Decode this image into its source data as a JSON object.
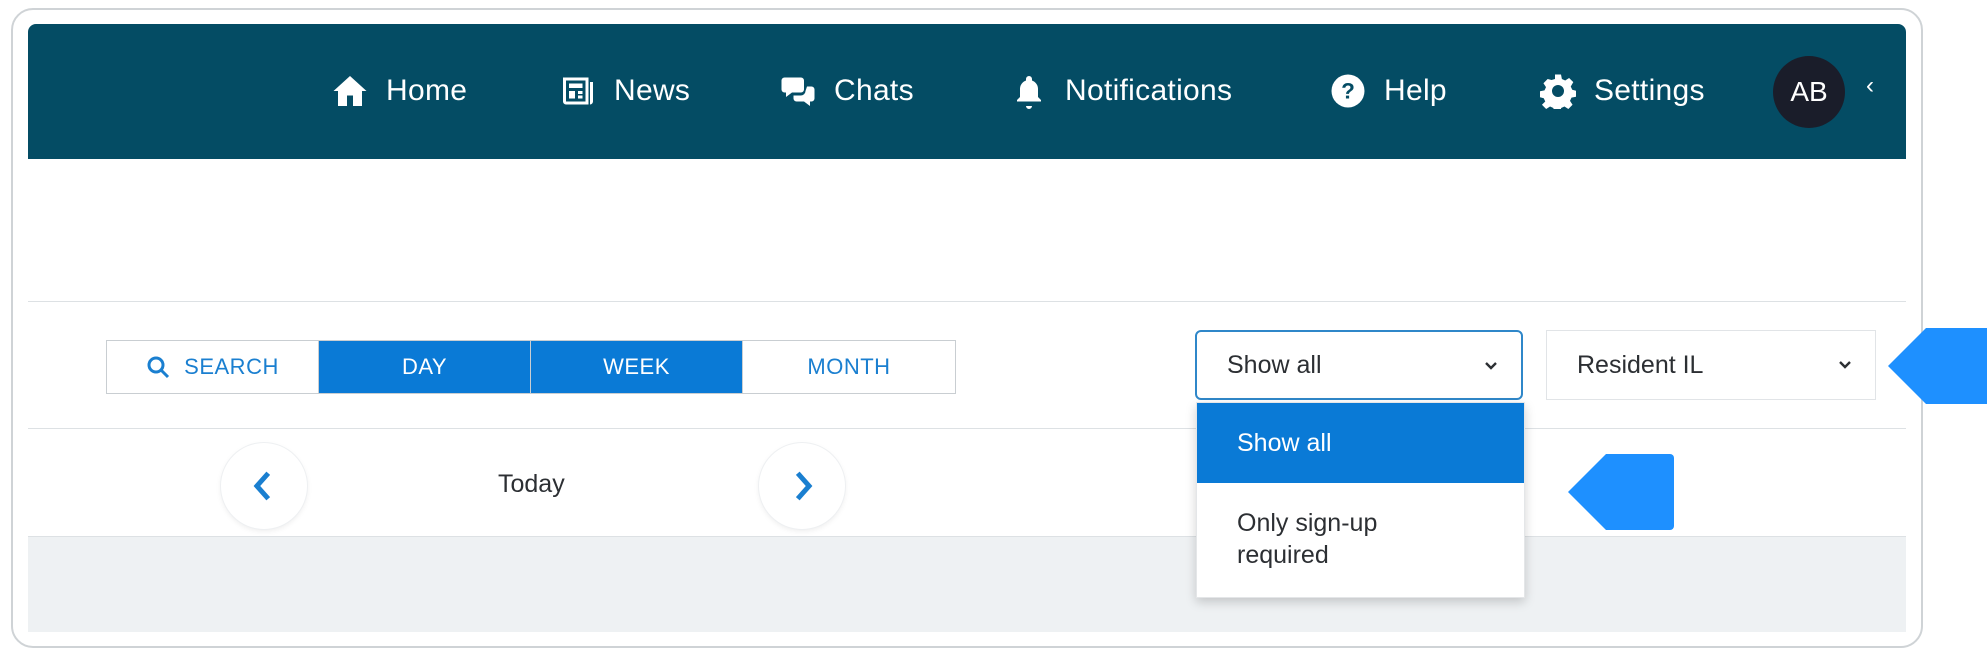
{
  "nav": {
    "home": "Home",
    "news": "News",
    "chats": "Chats",
    "notifications": "Notifications",
    "help": "Help",
    "settings": "Settings",
    "avatar_initials": "AB",
    "collapse_glyph": "‹"
  },
  "view_tabs": [
    {
      "label": "SEARCH",
      "icon": "search-icon",
      "active": false
    },
    {
      "label": "DAY",
      "active": true
    },
    {
      "label": "WEEK",
      "active": true
    },
    {
      "label": "MONTH",
      "active": false
    }
  ],
  "filter": {
    "selected": "Show all",
    "options": [
      "Show all",
      "Only sign-up\nrequired"
    ]
  },
  "resident": {
    "selected": "Resident IL"
  },
  "date_nav": {
    "current": "Today"
  },
  "colors": {
    "topbar": "#044c64",
    "accent": "#0a7ad6",
    "pointer": "#1e90ff"
  }
}
